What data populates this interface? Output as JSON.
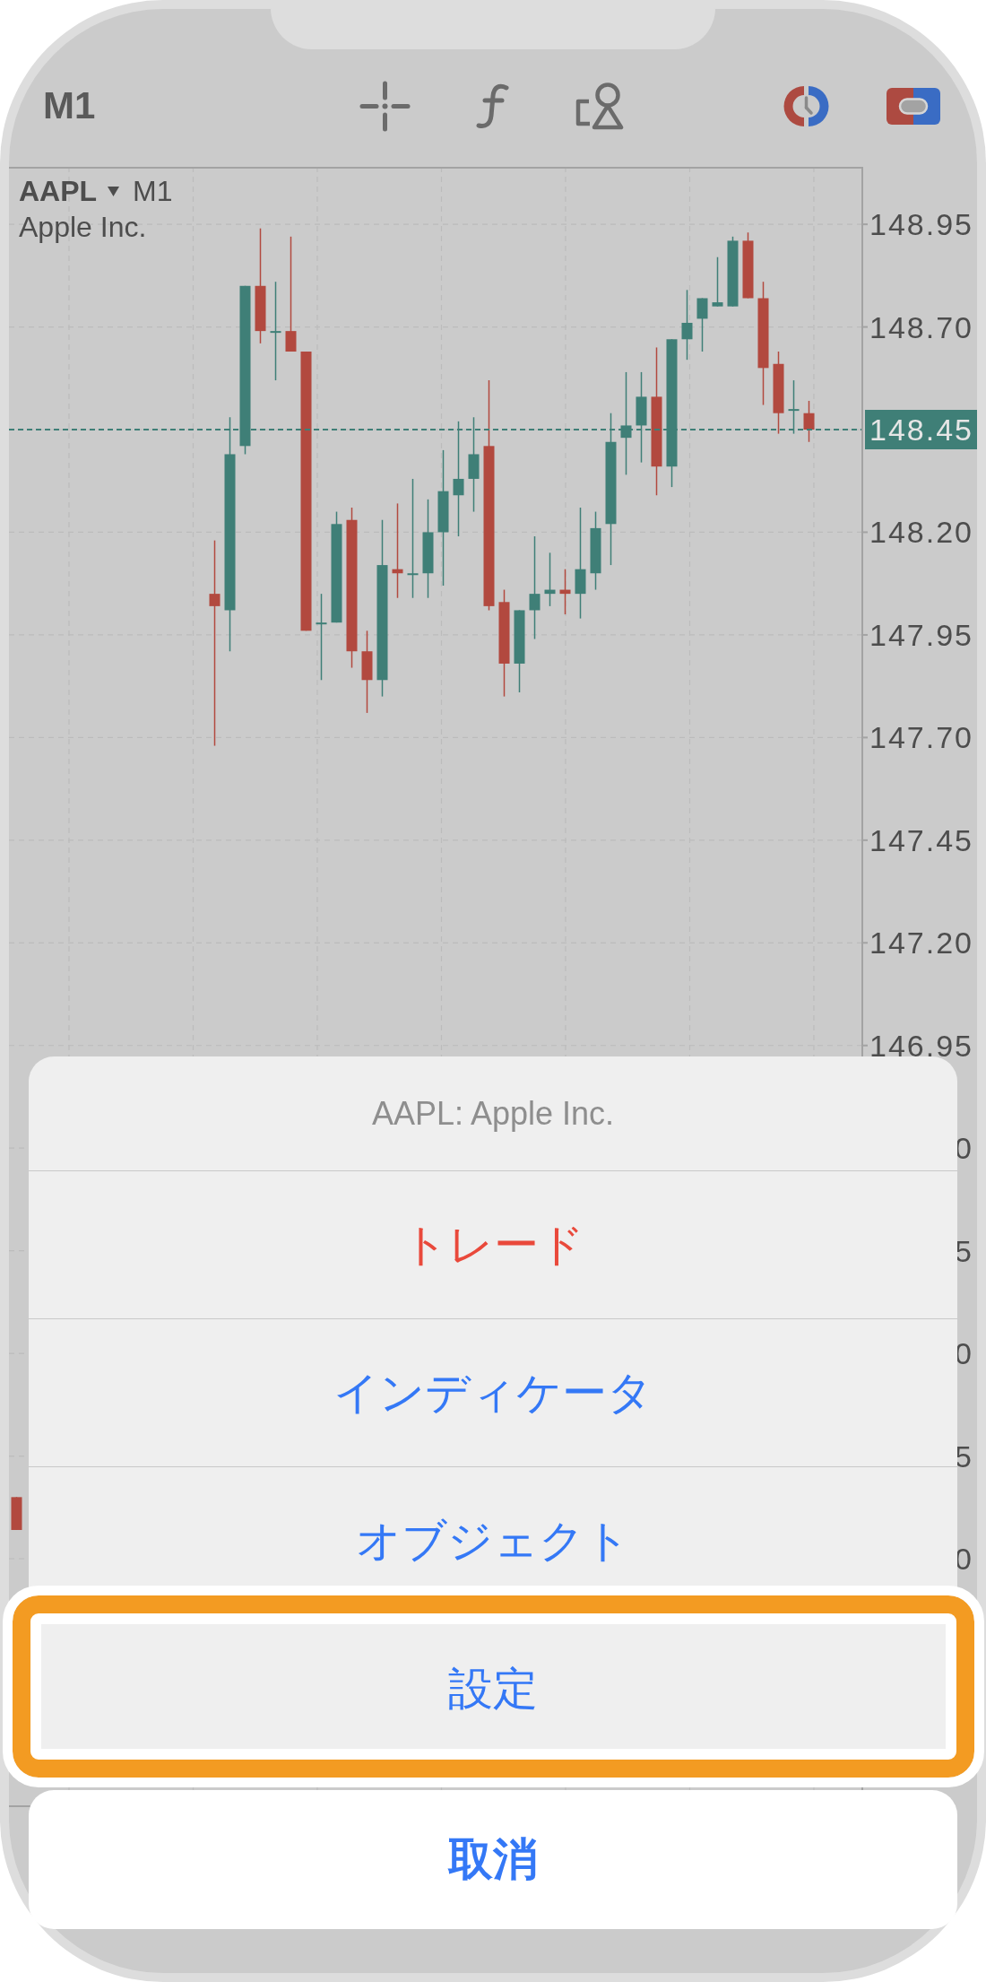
{
  "toolbar": {
    "timeframe": "M1"
  },
  "chart": {
    "symbol": "AAPL",
    "timeframe": "M1",
    "description": "Apple Inc.",
    "chart_data": {
      "type": "candlestick",
      "grid": true,
      "ylim": [
        145.095,
        149.09
      ],
      "yticks": [
        {
          "value": 148.95,
          "label": "148.95"
        },
        {
          "value": 148.7,
          "label": "148.70"
        },
        {
          "value": 148.45,
          "label": "148.45"
        },
        {
          "value": 148.2,
          "label": "148.20"
        },
        {
          "value": 147.95,
          "label": "147.95"
        },
        {
          "value": 147.7,
          "label": "147.70"
        },
        {
          "value": 147.45,
          "label": "147.45"
        },
        {
          "value": 147.2,
          "label": "147.20"
        },
        {
          "value": 146.95,
          "label": "146.95"
        }
      ],
      "categories": [
        null,
        null,
        null,
        null,
        null,
        null,
        null,
        null,
        null,
        null,
        null,
        null,
        null,
        null,
        null,
        null,
        null,
        null,
        null,
        null,
        null,
        null,
        null,
        null,
        null,
        null,
        null,
        null,
        null,
        null,
        null,
        null,
        null,
        null,
        null,
        null,
        null,
        null,
        null,
        null,
        null,
        null,
        null,
        null,
        null,
        null,
        null,
        null,
        null,
        null,
        null,
        null,
        null,
        null,
        null,
        null
      ],
      "ohlc": [
        [
          145.85,
          145.85,
          145.77,
          145.77
        ],
        null,
        null,
        null,
        null,
        null,
        null,
        null,
        null,
        null,
        null,
        null,
        null,
        [
          148.05,
          148.18,
          147.68,
          148.02
        ],
        [
          148.01,
          148.48,
          147.91,
          148.39
        ],
        [
          148.41,
          148.8,
          148.39,
          148.8
        ],
        [
          148.8,
          148.94,
          148.66,
          148.69
        ],
        [
          148.69,
          148.81,
          148.57,
          148.69
        ],
        [
          148.69,
          148.92,
          148.64,
          148.64
        ],
        [
          148.64,
          148.64,
          147.96,
          147.96
        ],
        [
          147.98,
          148.05,
          147.84,
          147.98
        ],
        [
          147.98,
          148.25,
          147.98,
          148.22
        ],
        [
          148.23,
          148.26,
          147.87,
          147.91
        ],
        [
          147.91,
          147.96,
          147.76,
          147.84
        ],
        [
          147.84,
          148.23,
          147.8,
          148.12
        ],
        [
          148.11,
          148.27,
          148.04,
          148.1
        ],
        [
          148.1,
          148.33,
          148.04,
          148.1
        ],
        [
          148.1,
          148.28,
          148.04,
          148.2
        ],
        [
          148.2,
          148.4,
          148.07,
          148.3
        ],
        [
          148.29,
          148.47,
          148.19,
          148.33
        ],
        [
          148.33,
          148.48,
          148.25,
          148.39
        ],
        [
          148.41,
          148.57,
          148.01,
          148.02
        ],
        [
          148.03,
          148.06,
          147.8,
          147.88
        ],
        [
          147.88,
          148.01,
          147.81,
          148.01
        ],
        [
          148.01,
          148.19,
          147.94,
          148.05
        ],
        [
          148.05,
          148.15,
          148.02,
          148.06
        ],
        [
          148.06,
          148.11,
          148.0,
          148.05
        ],
        [
          148.05,
          148.26,
          147.99,
          148.11
        ],
        [
          148.1,
          148.25,
          148.06,
          148.21
        ],
        [
          148.22,
          148.49,
          148.12,
          148.42
        ],
        [
          148.43,
          148.59,
          148.34,
          148.46
        ],
        [
          148.46,
          148.59,
          148.37,
          148.53
        ],
        [
          148.53,
          148.65,
          148.29,
          148.36
        ],
        [
          148.36,
          148.67,
          148.31,
          148.67
        ],
        [
          148.67,
          148.79,
          148.62,
          148.71
        ],
        [
          148.72,
          148.77,
          148.64,
          148.77
        ],
        [
          148.75,
          148.87,
          148.75,
          148.76
        ],
        [
          148.75,
          148.92,
          148.75,
          148.91
        ],
        [
          148.91,
          148.93,
          148.77,
          148.77
        ],
        [
          148.77,
          148.81,
          148.51,
          148.6
        ],
        [
          148.61,
          148.64,
          148.44,
          148.49
        ],
        [
          148.5,
          148.57,
          148.44,
          148.5
        ],
        [
          148.49,
          148.52,
          148.42,
          148.45
        ],
        null,
        null,
        null
      ],
      "ref_lines": [
        {
          "axis": "y",
          "value": 148.45,
          "color": "#3f7f77"
        }
      ]
    },
    "axis_label_fragments": [
      "0",
      "5",
      "0",
      "5",
      "0"
    ]
  },
  "action_sheet": {
    "title": "AAPL: Apple Inc.",
    "actions": [
      {
        "label": "トレード",
        "kind": "destructive",
        "highlighted": false
      },
      {
        "label": "インディケータ",
        "kind": "default",
        "highlighted": false
      },
      {
        "label": "オブジェクト",
        "kind": "default",
        "highlighted": false
      },
      {
        "label": "設定",
        "kind": "default",
        "highlighted": true
      }
    ],
    "cancel": "取消"
  }
}
